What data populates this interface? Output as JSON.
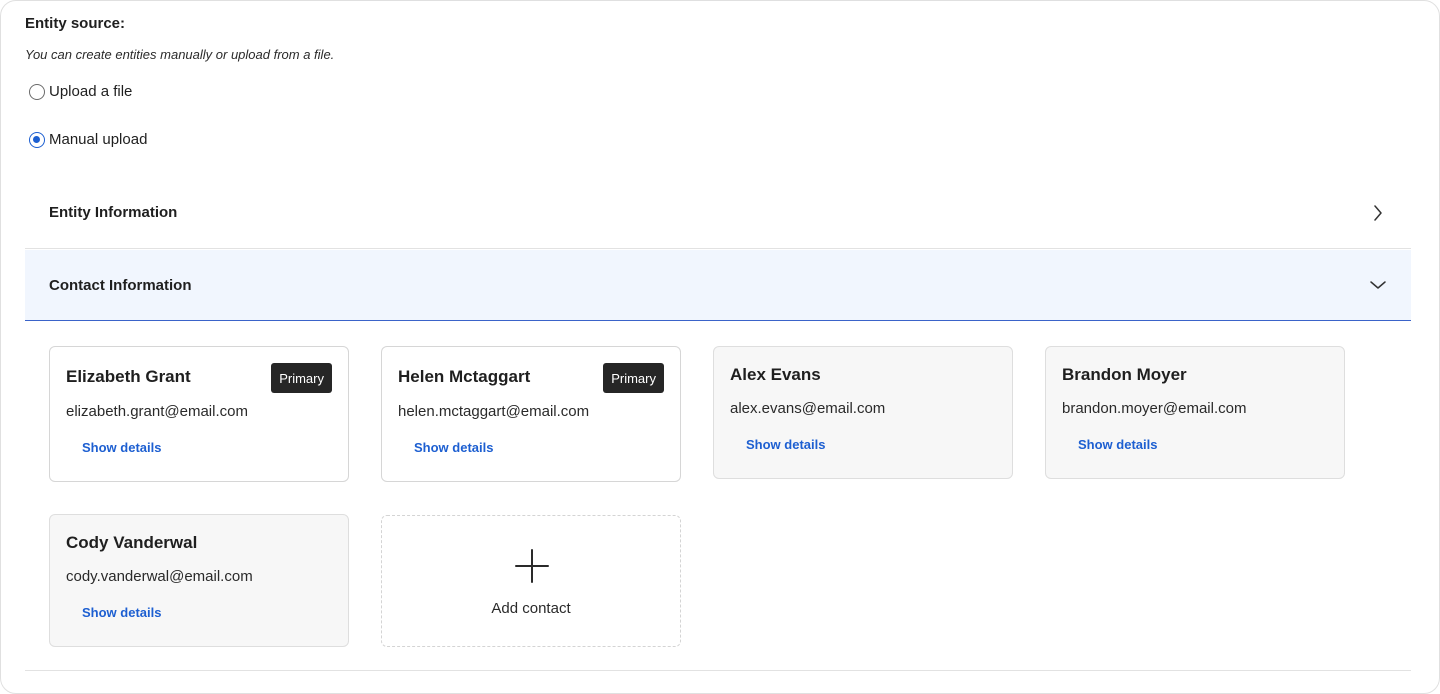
{
  "entity_source": {
    "title": "Entity source:",
    "hint": "You can create entities manually or upload from a file.",
    "options": [
      {
        "label": "Upload a file",
        "selected": false
      },
      {
        "label": "Manual upload",
        "selected": true
      }
    ]
  },
  "sections": {
    "entity_information": {
      "title": "Entity Information",
      "expanded": false,
      "chevron": "chevron-right-icon"
    },
    "contact_information": {
      "title": "Contact Information",
      "expanded": true,
      "chevron": "chevron-down-icon"
    }
  },
  "contacts": [
    {
      "name": "Elizabeth Grant",
      "email": "elizabeth.grant@email.com",
      "badge": "Primary",
      "details_label": "Show details"
    },
    {
      "name": "Helen Mctaggart",
      "email": "helen.mctaggart@email.com",
      "badge": "Primary",
      "details_label": "Show details"
    },
    {
      "name": "Alex Evans",
      "email": "alex.evans@email.com",
      "details_label": "Show details"
    },
    {
      "name": "Brandon Moyer",
      "email": "brandon.moyer@email.com",
      "details_label": "Show details"
    },
    {
      "name": "Cody Vanderwal",
      "email": "cody.vanderwal@email.com",
      "details_label": "Show details"
    }
  ],
  "add_contact": {
    "label": "Add contact",
    "icon": "plus-icon"
  },
  "colors": {
    "accent": "#1d5fd1",
    "section_active_bg": "#f1f6fe",
    "section_active_border": "#3a63c9",
    "badge_bg": "#262626"
  }
}
